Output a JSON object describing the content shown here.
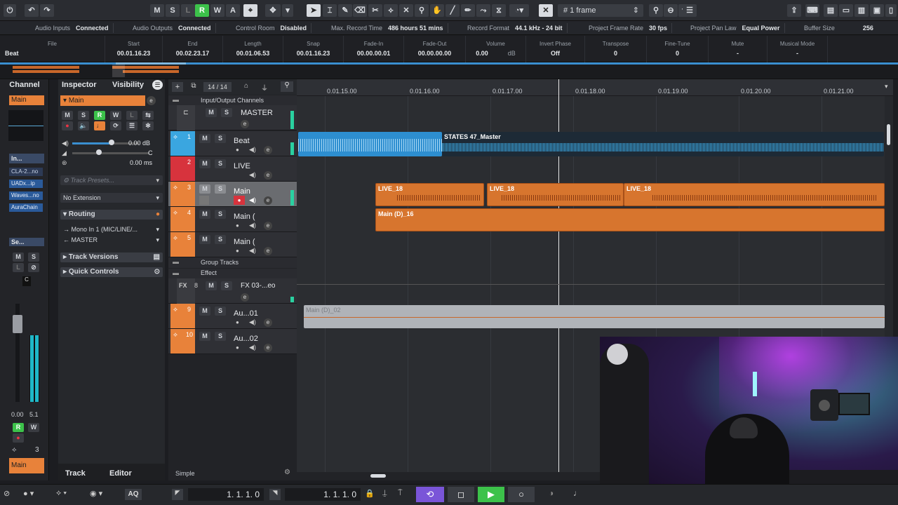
{
  "toolbar": {
    "msl": [
      "M",
      "S",
      "L",
      "R",
      "W",
      "A"
    ],
    "frame_label": "1 frame"
  },
  "status": {
    "items": [
      {
        "label": "Audio Inputs",
        "value": "Connected"
      },
      {
        "label": "Audio Outputs",
        "value": "Connected"
      },
      {
        "label": "Control Room",
        "value": "Disabled"
      },
      {
        "label": "Max. Record Time",
        "value": "486 hours 51 mins"
      },
      {
        "label": "Record Format",
        "value": "44.1 kHz - 24 bit"
      },
      {
        "label": "Project Frame Rate",
        "value": "30 fps"
      },
      {
        "label": "Project Pan Law",
        "value": "Equal Power"
      },
      {
        "label": "Buffer Size",
        "value": "256"
      }
    ]
  },
  "info": {
    "file": {
      "h": "File",
      "v": "Beat"
    },
    "start": {
      "h": "Start",
      "v": "00.01.16.23"
    },
    "end": {
      "h": "End",
      "v": "00.02.23.17"
    },
    "length": {
      "h": "Length",
      "v": "00.01.06.53"
    },
    "snap": {
      "h": "Snap",
      "v": "00.01.16.23"
    },
    "fadein": {
      "h": "Fade-In",
      "v": "00.00.00.01"
    },
    "fadeout": {
      "h": "Fade-Out",
      "v": "00.00.00.00"
    },
    "volume": {
      "h": "Volume",
      "v": "0.00",
      "unit": "dB"
    },
    "invert": {
      "h": "Invert Phase",
      "v": "Off"
    },
    "transpose": {
      "h": "Transpose",
      "v": "0"
    },
    "finetune": {
      "h": "Fine-Tune",
      "v": "0"
    },
    "mute": {
      "h": "Mute",
      "v": "-"
    },
    "musical": {
      "h": "Musical Mode",
      "v": "-"
    }
  },
  "channel": {
    "tab": "Channel",
    "name": "Main",
    "inserts_label": "In...",
    "plugins": [
      "CLA-2...no",
      "UADx...ip",
      "Waves...no",
      "AuraChain"
    ],
    "sends_label": "Se...",
    "c_label": "C",
    "level_left": "0.00",
    "level_right": "5.1",
    "num": "3",
    "bottom_name": "Main"
  },
  "inspector": {
    "tab_inspector": "Inspector",
    "tab_visibility": "Visibility",
    "track_name": "Main",
    "vol": "0.00 dB",
    "pan": "C",
    "delay": "0.00 ms",
    "presets_placeholder": "Track Presets...",
    "extension": "No Extension",
    "routing": "Routing",
    "input": "Mono In 1 (MIC/LINE/...",
    "output": "MASTER",
    "track_versions": "Track Versions",
    "quick_controls": "Quick Controls"
  },
  "tracklist": {
    "count": "14 / 14",
    "folder_io": "Input/Output Channels",
    "master": "MASTER",
    "tracks": [
      {
        "num": "1",
        "name": "Beat"
      },
      {
        "num": "2",
        "name": "LIVE"
      },
      {
        "num": "3",
        "name": "Main"
      },
      {
        "num": "4",
        "name": "Main ("
      },
      {
        "num": "5",
        "name": "Main ("
      }
    ],
    "group_tracks": "Group Tracks",
    "effect": "Effect",
    "fx_num": "8",
    "fx_tag": "FX",
    "fx_name": "FX 03-...eo",
    "tracks2": [
      {
        "num": "9",
        "name": "Au...01"
      },
      {
        "num": "10",
        "name": "Au...02"
      }
    ],
    "simple": "Simple"
  },
  "ruler": {
    "ticks": [
      "0.01.15.00",
      "0.01.16.00",
      "0.01.17.00",
      "0.01.18.00",
      "0.01.19.00",
      "0.01.20.00",
      "0.01.21.00"
    ]
  },
  "clips": {
    "master": "STATES 47_Master",
    "live": [
      "LIVE_18",
      "LIVE_18",
      "LIVE_18"
    ],
    "main": "Main (D)_16",
    "aux": "Main (D)_02"
  },
  "bottom": {
    "tab_track": "Track",
    "tab_editor": "Editor",
    "left_locator": "1. 1. 1.  0",
    "right_locator": "1. 1. 1.  0",
    "aq": "AQ"
  },
  "colors": {
    "accent_orange": "#e8823a",
    "beat_blue": "#3aa6e0",
    "live_red": "#d7333d",
    "record_green": "#3cc24a",
    "transport_purple": "#7a55d8"
  }
}
